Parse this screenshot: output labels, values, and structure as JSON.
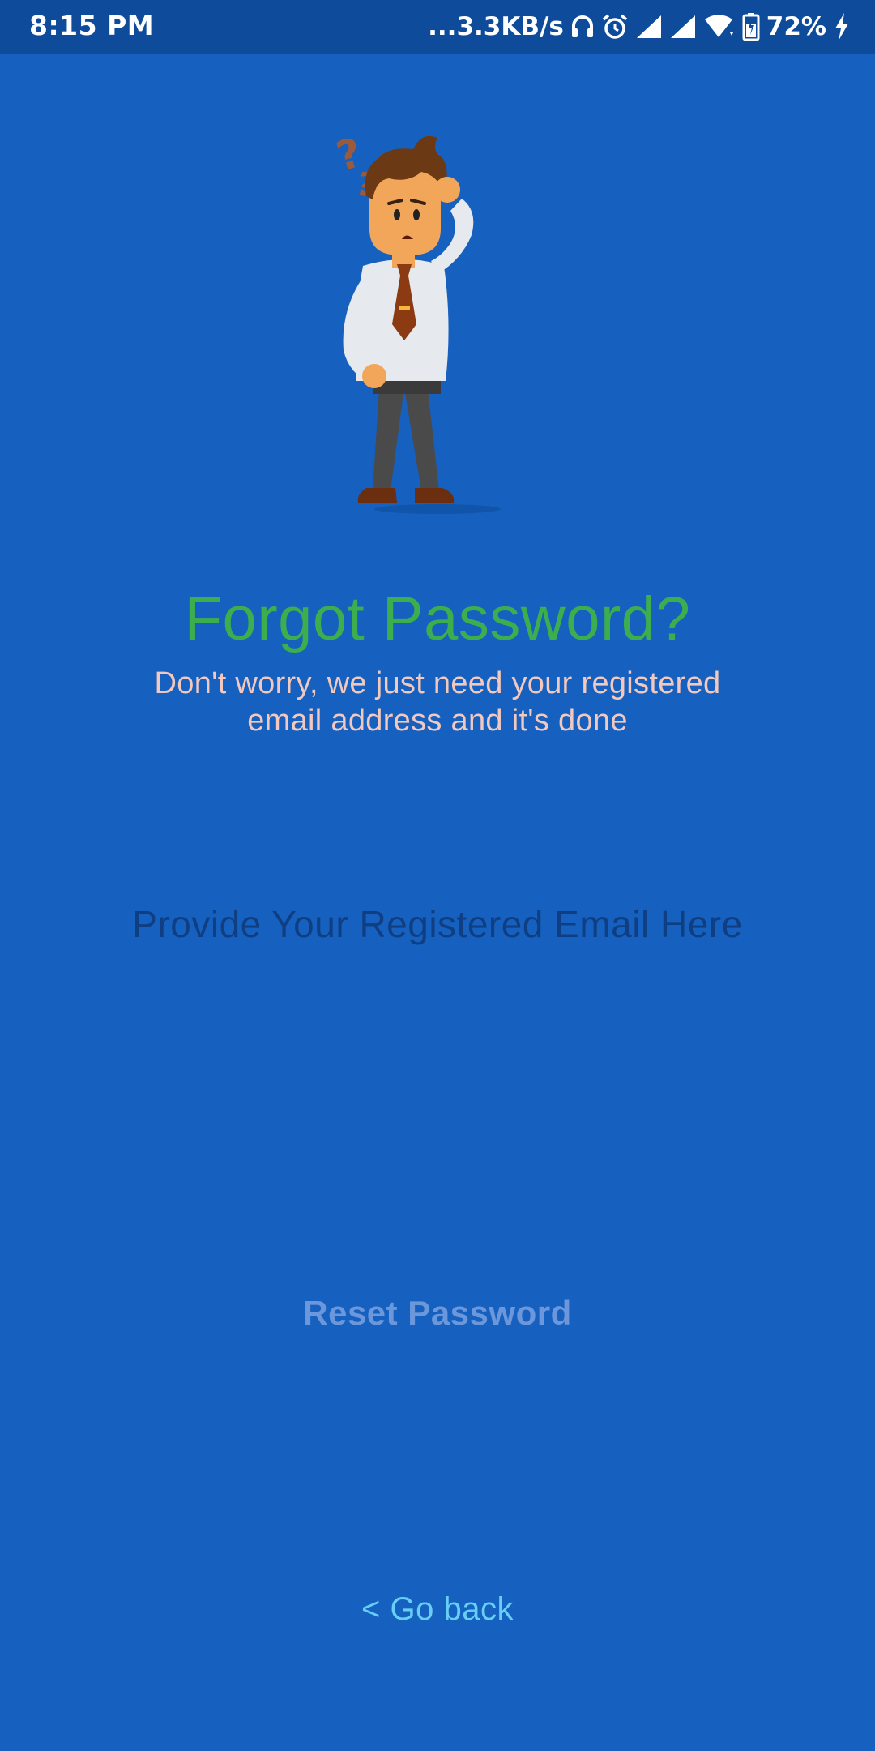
{
  "status_bar": {
    "time": "8:15 PM",
    "network_speed": "...3.3KB/s",
    "battery_percent": "72%",
    "icons": [
      "headphones-icon",
      "alarm-icon",
      "signal-icon",
      "signal-icon",
      "wifi-icon",
      "battery-icon",
      "charging-icon"
    ]
  },
  "illustration": {
    "icon": "confused-man-illustration"
  },
  "header": {
    "title": "Forgot Password?",
    "subtitle": "Don't worry, we just need your registered email address and it's done"
  },
  "form": {
    "email_placeholder": "Provide Your Registered Email Here",
    "email_value": "",
    "reset_label": "Reset Password"
  },
  "footer": {
    "go_back_label": "< Go back"
  },
  "colors": {
    "background": "#1661BF",
    "status_bar": "#0E4C9B",
    "title": "#3DAE4E",
    "subtitle": "#F3C8BE",
    "placeholder": "#0F3F82",
    "reset_button": "#6D97DB",
    "go_back": "#67CFF5"
  }
}
